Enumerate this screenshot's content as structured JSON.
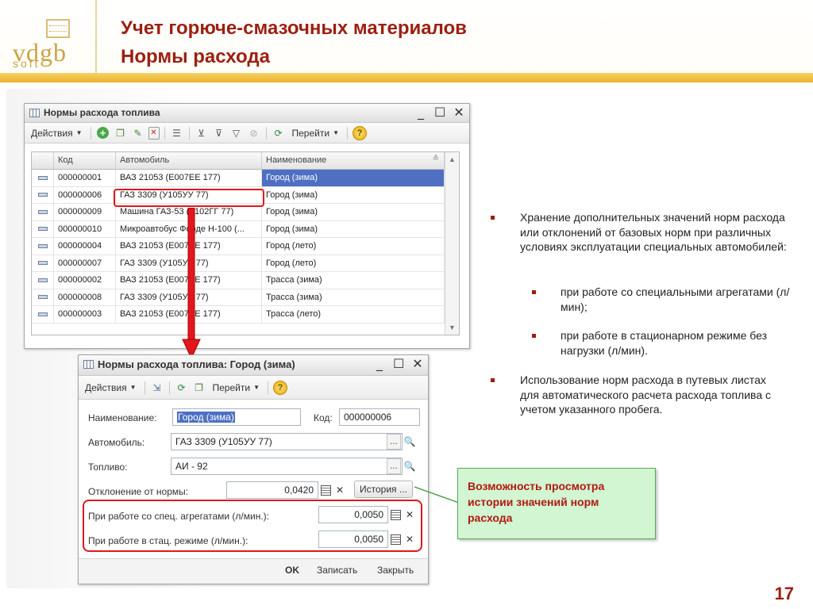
{
  "slide": {
    "title_line1": "Учет горюче-смазочных материалов",
    "title_line2": "Нормы расхода",
    "page_number": "17",
    "logo_text": "vdgb",
    "logo_sub": "soft"
  },
  "list_window": {
    "title": "Нормы расхода топлива",
    "controls": {
      "minimize": "_",
      "maximize": "☐",
      "close": "✕"
    },
    "toolbar": {
      "actions_label": "Действия",
      "goto_label": "Перейти",
      "icons": [
        "add-icon",
        "copy-icon",
        "edit-icon",
        "delete-icon",
        "hierarchy-icon",
        "filter-icon",
        "filter-value-icon",
        "filter-menu-icon",
        "clear-filter-icon",
        "refresh-icon",
        "help-icon"
      ]
    },
    "columns": [
      "Код",
      "Автомобиль",
      "Наименование"
    ],
    "rows": [
      {
        "code": "000000001",
        "car": "ВАЗ 21053 (Е007ЕЕ 177)",
        "name": "Город (зима)"
      },
      {
        "code": "000000006",
        "car": "ГАЗ 3309 (У105УУ 77)",
        "name": "Город (зима)"
      },
      {
        "code": "000000009",
        "car": "Машина ГАЗ-53 (Т102ГГ 77)",
        "name": "Город (зима)"
      },
      {
        "code": "000000010",
        "car": "Микроавтобус Форде Н-100 (...",
        "name": "Город (зима)"
      },
      {
        "code": "000000004",
        "car": "ВАЗ 21053 (Е007ЕЕ 177)",
        "name": "Город (лето)"
      },
      {
        "code": "000000007",
        "car": "ГАЗ 3309 (У105УУ 77)",
        "name": "Город (лето)"
      },
      {
        "code": "000000002",
        "car": "ВАЗ 21053 (Е007ЕЕ 177)",
        "name": "Трасса (зима)"
      },
      {
        "code": "000000008",
        "car": "ГАЗ 3309 (У105УУ 77)",
        "name": "Трасса (зима)"
      },
      {
        "code": "000000003",
        "car": "ВАЗ 21053 (Е007ЕЕ 177)",
        "name": "Трасса (лето)"
      }
    ]
  },
  "form_window": {
    "title": "Нормы расхода топлива: Город (зима)",
    "controls": {
      "minimize": "_",
      "maximize": "☐",
      "close": "✕"
    },
    "toolbar": {
      "actions_label": "Действия",
      "goto_label": "Перейти"
    },
    "name_label": "Наименование:",
    "name_value": "Город (зима)",
    "code_label": "Код:",
    "code_value": "000000006",
    "car_label": "Автомобиль:",
    "car_value": "ГАЗ 3309 (У105УУ 77)",
    "fuel_label": "Топливо:",
    "fuel_value": "АИ - 92",
    "deviation_label": "Отклонение от нормы:",
    "deviation_value": "0,0420",
    "history_label": "История ...",
    "special_label": "При работе со спец. агрегатами (л/мин.):",
    "special_value": "0,0050",
    "stationary_label": "При работе в стац. режиме (л/мин.):",
    "stationary_value": "0,0050",
    "ok_label": "OK",
    "save_label": "Записать",
    "close_label": "Закрыть",
    "dots": "...",
    "search_glyph": "🔍",
    "clear_glyph": "✕"
  },
  "bullets": {
    "b1": "Хранение дополнительных значений норм расхода или отклонений от базовых норм при различных условиях эксплуатации специальных автомобилей:",
    "b1a": "при работе со специальными агрегатами (л/мин);",
    "b1b": "при работе в стационарном режиме без нагрузки (л/мин).",
    "b2": "Использование норм расхода в путевых листах для автоматического расчета расхода топлива с учетом указанного пробега."
  },
  "callout": "Возможность просмотра истории значений норм расхода",
  "colors": {
    "title": "#9c1f10",
    "accent_bar": "#ecb02c",
    "selection": "#4e6fc2",
    "highlight_box": "#e0181e",
    "callout_bg": "#d2f5d2"
  }
}
